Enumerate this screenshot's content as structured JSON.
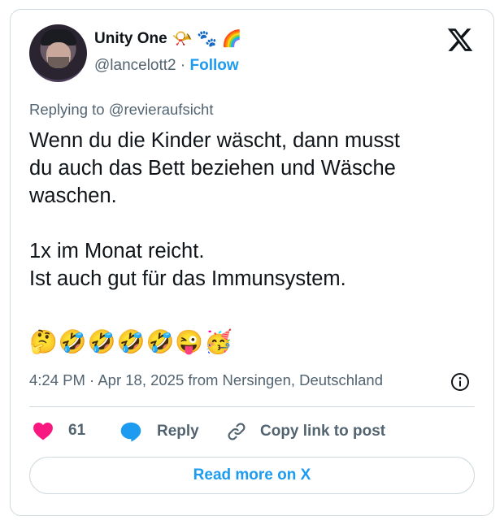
{
  "author": {
    "name": "Unity One",
    "name_emojis": "📯 🐾 🌈",
    "handle": "@lancelott2",
    "separator": "·",
    "follow_label": "Follow"
  },
  "reply_to": "Replying to @revieraufsicht",
  "tweet_text": "Wenn du die Kinder wäscht, dann musst\ndu auch das Bett beziehen und Wäsche\nwaschen.\n\n1x im Monat reicht.\nIst auch gut für das Immunsystem.",
  "tweet_emojis": "🤔🤣🤣🤣🤣😜🥳",
  "meta": "4:24 PM · Apr 18, 2025 from Nersingen, Deutschland",
  "actions": {
    "like_count": "61",
    "reply_label": "Reply",
    "copy_label": "Copy link to post"
  },
  "read_more_label": "Read more on X",
  "colors": {
    "accent": "#1d9bf0",
    "heart": "#f91880",
    "text_secondary": "#536471",
    "border": "#cfd9de"
  }
}
